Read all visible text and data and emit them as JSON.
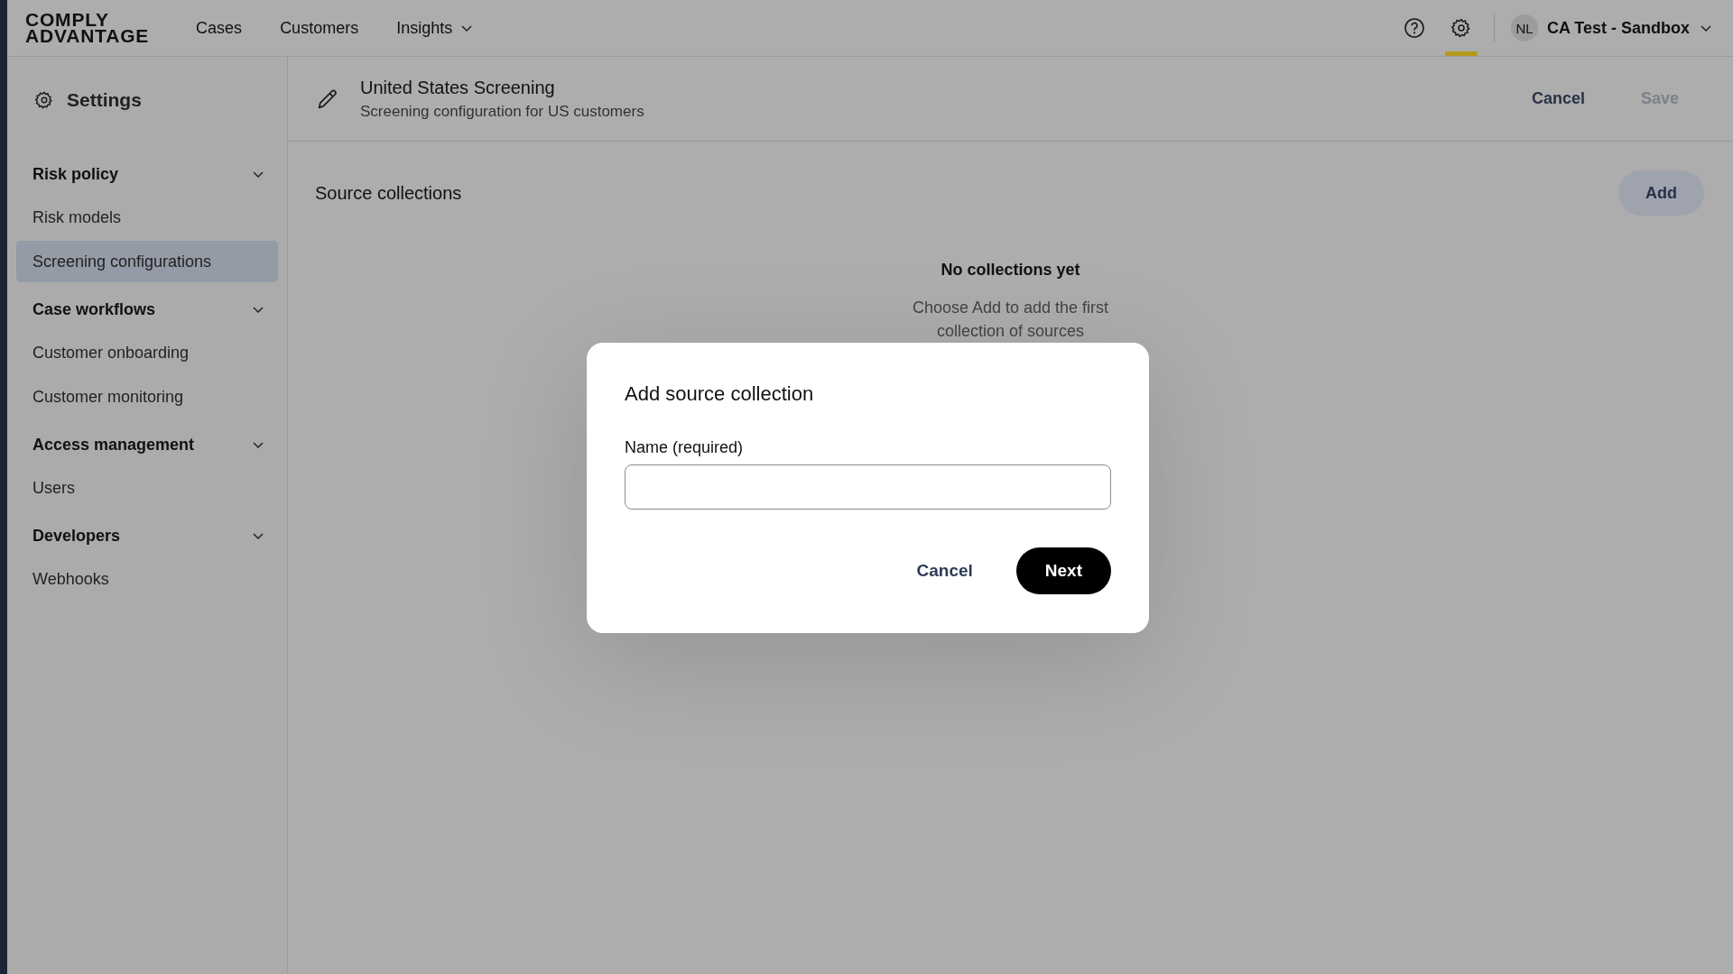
{
  "topbar": {
    "logo": [
      "COMPLY",
      "ADVANTAGE"
    ],
    "nav": [
      {
        "label": "Cases",
        "dropdown": false
      },
      {
        "label": "Customers",
        "dropdown": false
      },
      {
        "label": "Insights",
        "dropdown": true
      }
    ],
    "icons": [
      {
        "kind": "help",
        "selected": false
      },
      {
        "kind": "settings",
        "selected": true
      }
    ],
    "account": {
      "initials": "NL",
      "name": "CA Test - Sandbox"
    }
  },
  "sidebar": {
    "title": "Settings",
    "sections": [
      {
        "title": "Risk policy",
        "expanded": true,
        "children": [
          {
            "label": "Risk models",
            "selected": false
          },
          {
            "label": "Screening configurations",
            "selected": true
          }
        ]
      },
      {
        "title": "Case workflows",
        "expanded": true,
        "children": [
          {
            "label": "Customer onboarding",
            "selected": false
          },
          {
            "label": "Customer monitoring",
            "selected": false
          }
        ]
      },
      {
        "title": "Access management",
        "expanded": true,
        "children": [
          {
            "label": "Users",
            "selected": false
          }
        ]
      },
      {
        "title": "Developers",
        "expanded": true,
        "children": [
          {
            "label": "Webhooks",
            "selected": false
          }
        ]
      }
    ]
  },
  "header": {
    "title": "United States Screening",
    "subtitle": "Screening configuration for US customers",
    "actions": [
      {
        "label": "Cancel",
        "disabled": false
      },
      {
        "label": "Save",
        "disabled": true
      }
    ]
  },
  "section": {
    "title": "Source collections",
    "add_button": "Add",
    "empty_title": "No collections yet",
    "empty_text": "Choose Add to add the first collection of sources"
  },
  "dialog": {
    "title": "Add source collection",
    "field_label": "Name (required)",
    "buttons": [
      {
        "label": "Cancel",
        "kind": "secondary"
      },
      {
        "label": "Next",
        "kind": "primary"
      }
    ]
  }
}
